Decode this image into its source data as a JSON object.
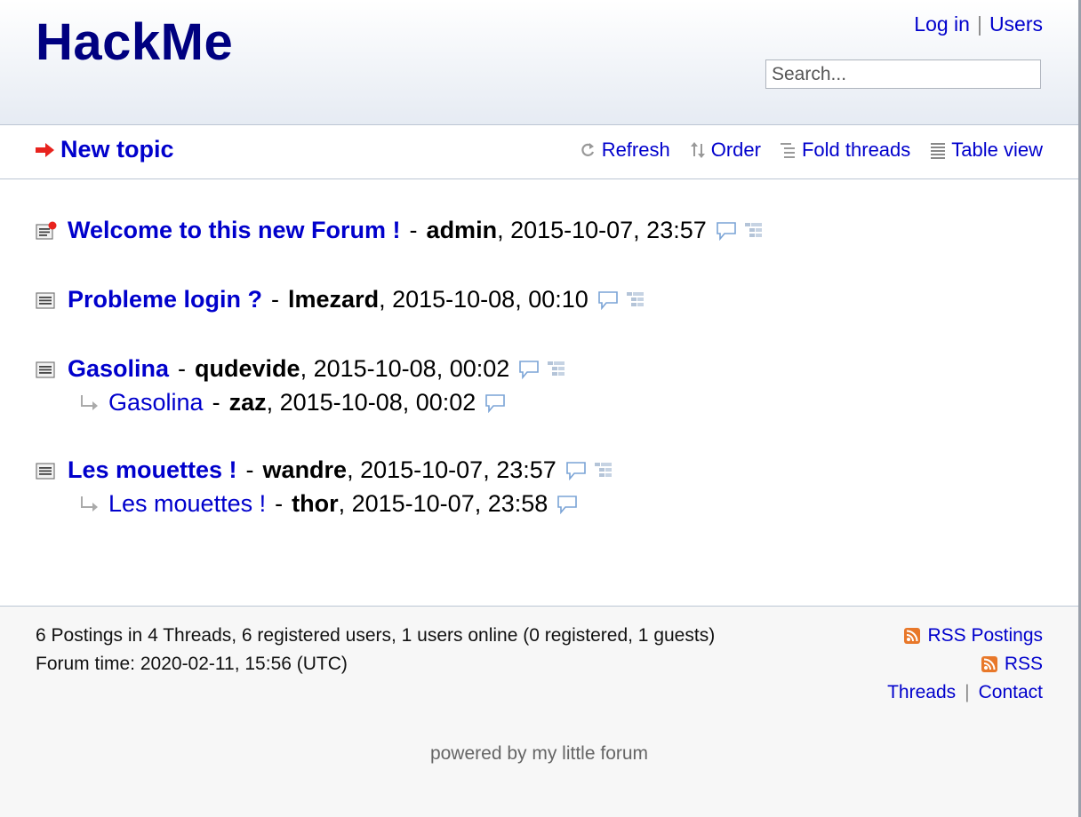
{
  "header": {
    "logo": "HackMe",
    "login_label": "Log in",
    "separator": "|",
    "users_label": "Users",
    "search_placeholder": "Search..."
  },
  "subnav": {
    "new_topic_label": "New topic",
    "refresh_label": "Refresh",
    "order_label": "Order",
    "fold_label": "Fold threads",
    "table_label": "Table view"
  },
  "threads": [
    {
      "title": "Welcome to this new Forum !",
      "dash": "-",
      "author": "admin",
      "date": ", 2015-10-07, 23:57",
      "new": true
    },
    {
      "title": "Probleme login ?",
      "dash": "-",
      "author": "lmezard",
      "date": ", 2015-10-08, 00:10"
    },
    {
      "title": "Gasolina",
      "dash": "-",
      "author": "qudevide",
      "date": ", 2015-10-08, 00:02",
      "reply": {
        "title": "Gasolina",
        "dash": "-",
        "author": "zaz",
        "date": ", 2015-10-08, 00:02"
      }
    },
    {
      "title": "Les mouettes !",
      "dash": "-",
      "author": "wandre",
      "date": ", 2015-10-07, 23:57",
      "reply": {
        "title": "Les mouettes !",
        "dash": "-",
        "author": "thor",
        "date": ", 2015-10-07, 23:58"
      }
    }
  ],
  "footer": {
    "stats_line": "6 Postings in 4 Threads, 6 registered users, 1 users online (0 registered, 1 guests)",
    "forum_time": "Forum time: 2020-02-11, 15:56 (UTC)",
    "rss_postings": "RSS Postings",
    "rss": "RSS",
    "threads_label": "Threads",
    "separator": "|",
    "contact_label": "Contact",
    "powered": "powered by my little forum"
  },
  "colors": {
    "link": "#0000cc",
    "logo": "#000080",
    "arrow": "#e8231e",
    "rss": "#e8782a"
  }
}
